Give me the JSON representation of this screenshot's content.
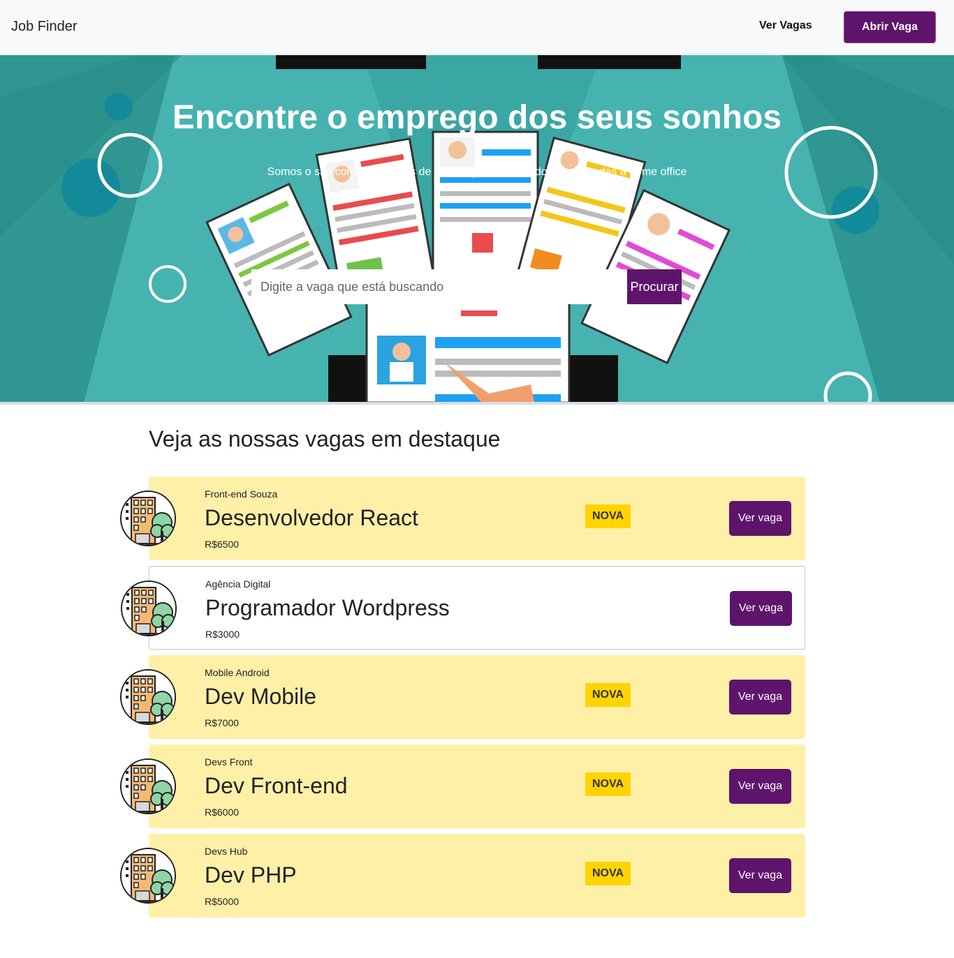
{
  "navbar": {
    "brand": "Job Finder",
    "link_label": "Ver Vagas",
    "cta_label": "Abrir Vaga"
  },
  "hero": {
    "title": "Encontre o emprego dos seus sonhos",
    "subtitle": "Somos o site com mais vagas de tecnologia no mercado, direcionadas a home office",
    "search_placeholder": "Digite a vaga que está buscando",
    "search_button": "Procurar"
  },
  "section": {
    "title": "Veja as nossas vagas em destaque"
  },
  "jobs": [
    {
      "company": "Front-end Souza",
      "title": "Desenvolvedor React",
      "salary": "R$6500",
      "badge": "NOVA",
      "button": "Ver vaga",
      "featured": true
    },
    {
      "company": "Agência Digital",
      "title": "Programador Wordpress",
      "salary": "R$3000",
      "badge": "",
      "button": "Ver vaga",
      "featured": false
    },
    {
      "company": "Mobile Android",
      "title": "Dev Mobile",
      "salary": "R$7000",
      "badge": "NOVA",
      "button": "Ver vaga",
      "featured": true
    },
    {
      "company": "Devs Front",
      "title": "Dev Front-end",
      "salary": "R$6000",
      "badge": "NOVA",
      "button": "Ver vaga",
      "featured": true
    },
    {
      "company": "Devs Hub",
      "title": "Dev PHP",
      "salary": "R$5000",
      "badge": "NOVA",
      "button": "Ver vaga",
      "featured": true
    }
  ],
  "colors": {
    "primary": "#5e146c",
    "featured_bg": "#fff0a8",
    "badge": "#ffd400",
    "hero_teal": "#3fa8a5"
  },
  "icons": {
    "job_logo": "company-building-icon"
  }
}
